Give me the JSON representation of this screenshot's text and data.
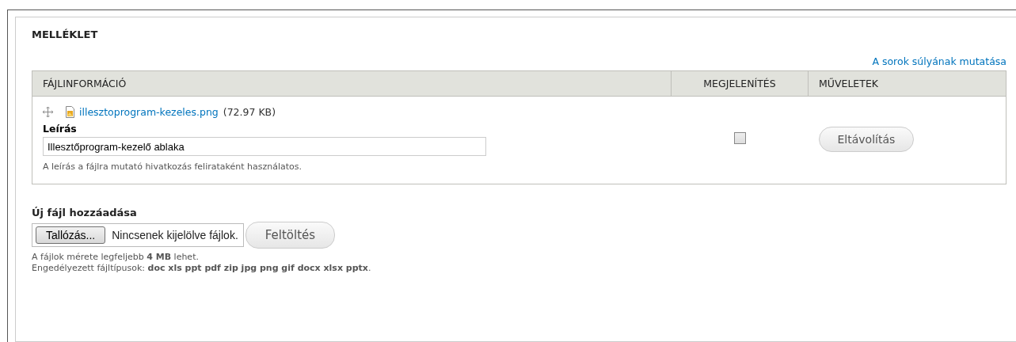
{
  "fieldset": {
    "legend": "MELLÉKLET"
  },
  "weight_toggle": {
    "label": "A sorok súlyának mutatása"
  },
  "table": {
    "columns": [
      "FÁJLINFORMÁCIÓ",
      "MEGJELENÍTÉS",
      "MŰVELETEK"
    ],
    "rows": [
      {
        "file_name": "illesztoprogram-kezeles.png",
        "file_size": "(72.97 KB)",
        "description_label": "Leírás",
        "description_value": "Illesztőprogram-kezelő ablaka",
        "description_help": "A leírás a fájlra mutató hivatkozás felirataként használatos.",
        "display": {
          "checked": false
        },
        "action": "Eltávolítás"
      }
    ]
  },
  "upload": {
    "label": "Új fájl hozzáadása",
    "browse_button": "Tallózás...",
    "file_status": "Nincsenek kijelölve fájlok.",
    "upload_button": "Feltöltés",
    "help": [
      "A fájlok mérete legfeljebb **4 MB** lehet.",
      "Engedélyezett fájltípusok: **doc xls ppt pdf zip jpg png gif docx xlsx pptx**."
    ]
  }
}
